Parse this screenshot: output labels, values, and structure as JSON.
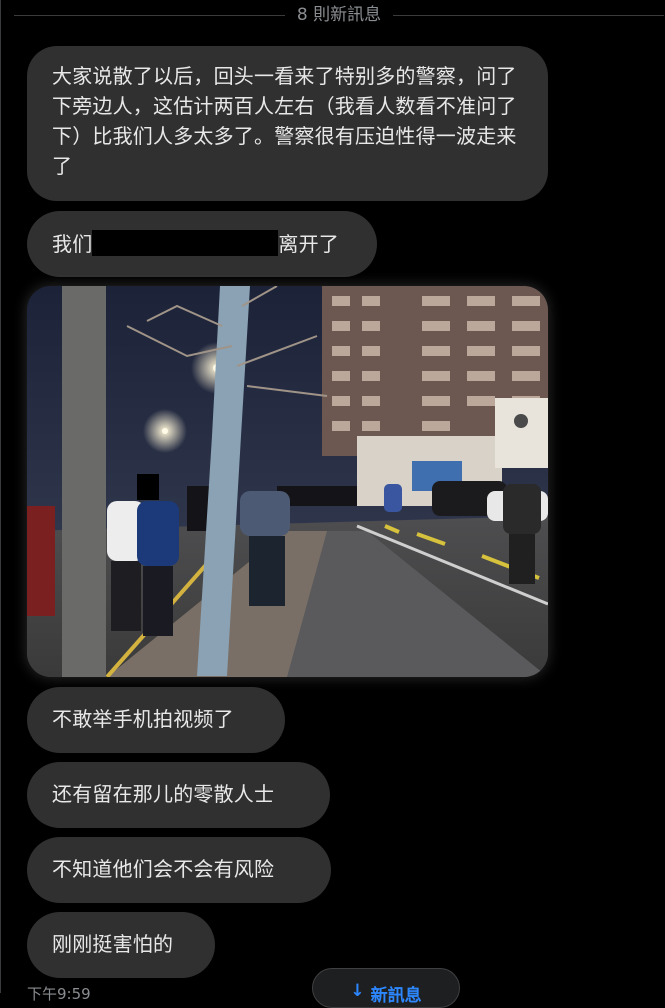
{
  "divider": {
    "label": "8 則新訊息"
  },
  "messages": [
    {
      "text": "大家说散了以后，回头一看来了特别多的警察，问了下旁边人，这估计两百人左右（我看人数看不准问了下）比我们人多太多了。警察很有压迫性得一波走来了"
    },
    {
      "text_before": "我们",
      "text_after": "离开了"
    },
    {
      "text": "不敢举手机拍视频了"
    },
    {
      "text": "还有留在那儿的零散人士"
    },
    {
      "text": "不知道他们会不会有风险"
    },
    {
      "text": "刚刚挺害怕的"
    }
  ],
  "footer": {
    "time_partial": "下午9:59",
    "new_messages_label": "新訊息",
    "arrow": "↓"
  },
  "colors": {
    "bubble": "#303030",
    "background": "#000000",
    "accent": "#2d88ff",
    "muted": "#8a8d91"
  },
  "photo": {
    "content": "street-scene-night"
  }
}
